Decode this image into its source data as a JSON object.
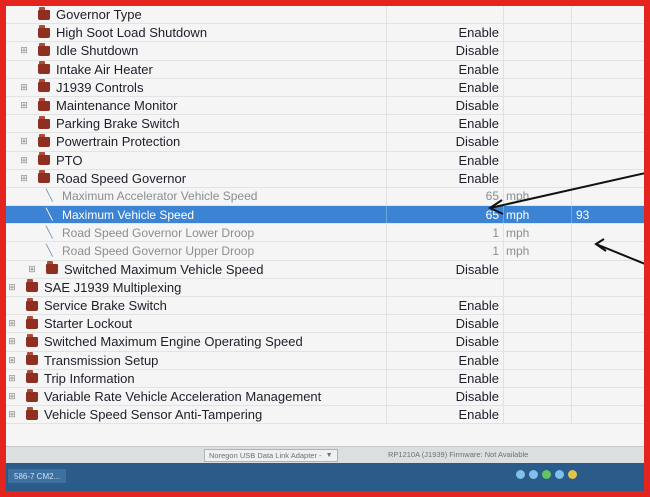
{
  "rows": [
    {
      "name": "Governor Type",
      "value": "",
      "unit": "",
      "extra": "",
      "kind": "folder",
      "exp": false,
      "indent": 1
    },
    {
      "name": "High Soot Load Shutdown",
      "value": "Enable",
      "unit": "",
      "extra": "",
      "kind": "folder",
      "exp": false,
      "indent": 1
    },
    {
      "name": "Idle Shutdown",
      "value": "Disable",
      "unit": "",
      "extra": "",
      "kind": "folder",
      "exp": true,
      "indent": 1
    },
    {
      "name": "Intake Air Heater",
      "value": "Enable",
      "unit": "",
      "extra": "",
      "kind": "folder",
      "exp": false,
      "indent": 1
    },
    {
      "name": "J1939 Controls",
      "value": "Enable",
      "unit": "",
      "extra": "",
      "kind": "folder",
      "exp": true,
      "indent": 1
    },
    {
      "name": "Maintenance Monitor",
      "value": "Disable",
      "unit": "",
      "extra": "",
      "kind": "folder",
      "exp": true,
      "indent": 1
    },
    {
      "name": "Parking Brake Switch",
      "value": "Enable",
      "unit": "",
      "extra": "",
      "kind": "folder",
      "exp": false,
      "indent": 1
    },
    {
      "name": "Powertrain Protection",
      "value": "Disable",
      "unit": "",
      "extra": "",
      "kind": "folder",
      "exp": true,
      "indent": 1
    },
    {
      "name": "PTO",
      "value": "Enable",
      "unit": "",
      "extra": "",
      "kind": "folder",
      "exp": true,
      "indent": 1
    },
    {
      "name": "Road Speed Governor",
      "value": "Enable",
      "unit": "",
      "extra": "",
      "kind": "folder",
      "exp": true,
      "indent": 1
    },
    {
      "name": "Maximum Accelerator Vehicle Speed",
      "value": "65",
      "unit": "mph",
      "extra": "",
      "kind": "param",
      "exp": false,
      "indent": 2
    },
    {
      "name": "Maximum Vehicle Speed",
      "value": "65",
      "unit": "mph",
      "extra": "93",
      "kind": "param",
      "exp": false,
      "indent": 2,
      "selected": true
    },
    {
      "name": "Road Speed Governor Lower Droop",
      "value": "1",
      "unit": "mph",
      "extra": "",
      "kind": "param",
      "exp": false,
      "indent": 2
    },
    {
      "name": "Road Speed Governor Upper Droop",
      "value": "1",
      "unit": "mph",
      "extra": "",
      "kind": "param",
      "exp": false,
      "indent": 2
    },
    {
      "name": "Switched Maximum Vehicle Speed",
      "value": "Disable",
      "unit": "",
      "extra": "",
      "kind": "folder",
      "exp": true,
      "indent": 2
    },
    {
      "name": "SAE J1939 Multiplexing",
      "value": "",
      "unit": "",
      "extra": "",
      "kind": "folder",
      "exp": true,
      "indent": 0
    },
    {
      "name": "Service Brake Switch",
      "value": "Enable",
      "unit": "",
      "extra": "",
      "kind": "folder",
      "exp": false,
      "indent": 0
    },
    {
      "name": "Starter Lockout",
      "value": "Disable",
      "unit": "",
      "extra": "",
      "kind": "folder",
      "exp": true,
      "indent": 0
    },
    {
      "name": "Switched Maximum Engine Operating Speed",
      "value": "Disable",
      "unit": "",
      "extra": "",
      "kind": "folder",
      "exp": true,
      "indent": 0
    },
    {
      "name": "Transmission Setup",
      "value": "Enable",
      "unit": "",
      "extra": "",
      "kind": "folder",
      "exp": true,
      "indent": 0
    },
    {
      "name": "Trip Information",
      "value": "Enable",
      "unit": "",
      "extra": "",
      "kind": "folder",
      "exp": true,
      "indent": 0
    },
    {
      "name": "Variable Rate Vehicle Acceleration Management",
      "value": "Disable",
      "unit": "",
      "extra": "",
      "kind": "folder",
      "exp": true,
      "indent": 0
    },
    {
      "name": "Vehicle Speed Sensor Anti-Tampering",
      "value": "Enable",
      "unit": "",
      "extra": "",
      "kind": "folder",
      "exp": true,
      "indent": 0
    }
  ],
  "statusbar": {
    "adapter": "Noregon USB Data Link Adapter -",
    "firmware": "RP1210A (J1939)  Firmware: Not Available"
  },
  "taskbar": {
    "item": "586-7 CM2..."
  },
  "colors": {
    "frame": "#e3241f",
    "selection": "#3d83d3",
    "folder_icon": "#8e2f22"
  }
}
